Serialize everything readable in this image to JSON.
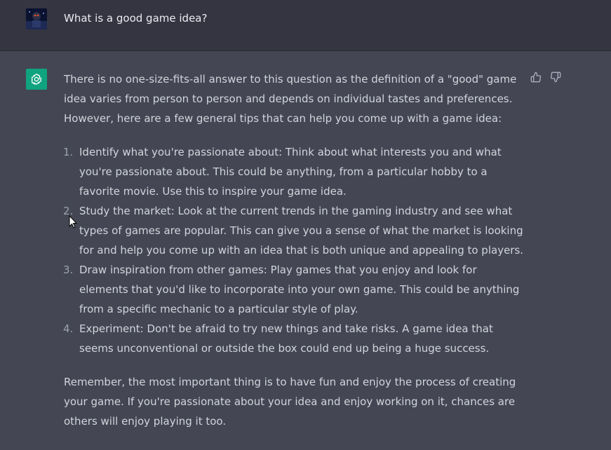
{
  "user": {
    "message": "What is a good game idea?",
    "avatar_icon": "user-avatar-image"
  },
  "assistant": {
    "avatar_icon": "openai-logo-icon",
    "avatar_color": "#10a37f",
    "intro_lines": [
      "There is no one-size-fits-all answer to this question as the definition of a \"good\" game",
      "idea varies from person to person and depends on individual tastes and preferences.",
      "However, here are a few general tips that can help you come up with a game idea:"
    ],
    "tips": [
      {
        "number": "1.",
        "lines": [
          "Identify what you're passionate about: Think about what interests you and what",
          "you're passionate about. This could be anything, from a particular hobby to a",
          "favorite movie. Use this to inspire your game idea."
        ]
      },
      {
        "number": "2.",
        "lines": [
          "Study the market: Look at the current trends in the gaming industry and see what",
          "types of games are popular. This can give you a sense of what the market is looking",
          "for and help you come up with an idea that is both unique and appealing to players."
        ]
      },
      {
        "number": "3.",
        "lines": [
          "Draw inspiration from other games: Play games that you enjoy and look for",
          "elements that you'd like to incorporate into your own game. This could be anything",
          "from a specific mechanic to a particular style of play."
        ]
      },
      {
        "number": "4.",
        "lines": [
          "Experiment: Don't be afraid to try new things and take risks. A game idea that",
          "seems unconventional or outside the box could end up being a huge success."
        ]
      }
    ],
    "closing_lines": [
      "Remember, the most important thing is to have fun and enjoy the process of creating",
      "your game. If you're passionate about your idea and enjoy working on it, chances are",
      "others will enjoy playing it too."
    ]
  },
  "feedback": {
    "thumbs_up_icon": "thumbs-up-icon",
    "thumbs_down_icon": "thumbs-down-icon"
  },
  "colors": {
    "user_row_bg": "#343541",
    "assistant_row_bg": "#444654",
    "text": "#d1d5db"
  }
}
